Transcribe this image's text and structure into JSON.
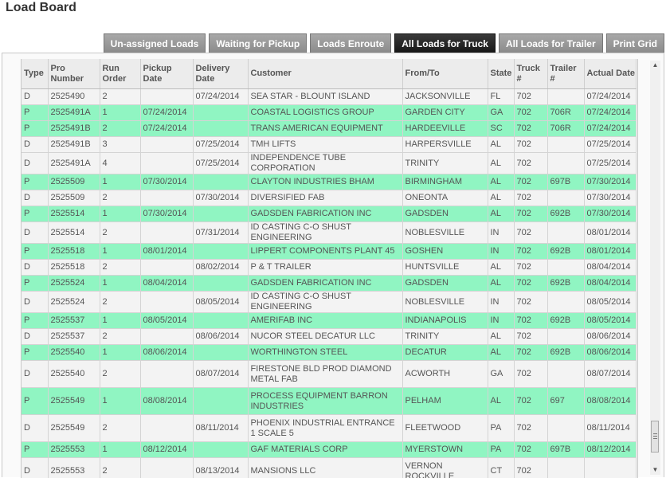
{
  "page": {
    "title": "Load Board"
  },
  "tabs": [
    {
      "label": "Un-assigned Loads",
      "active": false
    },
    {
      "label": "Waiting for Pickup",
      "active": false
    },
    {
      "label": "Loads Enroute",
      "active": false
    },
    {
      "label": "All Loads for Truck",
      "active": true
    },
    {
      "label": "All Loads for Trailer",
      "active": false
    },
    {
      "label": "Print Grid",
      "active": false
    }
  ],
  "grid": {
    "columns": [
      "Type",
      "Pro Number",
      "Run Order",
      "Pickup Date",
      "Delivery Date",
      "Customer",
      "From/To",
      "State",
      "Truck #",
      "Trailer #",
      "Actual Date"
    ],
    "rows": [
      [
        "D",
        "2525490",
        "2",
        "",
        "07/24/2014",
        "SEA STAR - BLOUNT ISLAND",
        "JACKSONVILLE",
        "FL",
        "702",
        "",
        "07/24/2014"
      ],
      [
        "P",
        "2525491A",
        "1",
        "07/24/2014",
        "",
        "COASTAL LOGISTICS GROUP",
        "GARDEN CITY",
        "GA",
        "702",
        "706R",
        "07/24/2014"
      ],
      [
        "P",
        "2525491B",
        "2",
        "07/24/2014",
        "",
        "TRANS AMERICAN EQUIPMENT",
        "HARDEEVILLE",
        "SC",
        "702",
        "706R",
        "07/24/2014"
      ],
      [
        "D",
        "2525491B",
        "3",
        "",
        "07/25/2014",
        "TMH LIFTS",
        "HARPERSVILLE",
        "AL",
        "702",
        "",
        "07/25/2014"
      ],
      [
        "D",
        "2525491A",
        "4",
        "",
        "07/25/2014",
        "INDEPENDENCE TUBE CORPORATION",
        "TRINITY",
        "AL",
        "702",
        "",
        "07/25/2014"
      ],
      [
        "P",
        "2525509",
        "1",
        "07/30/2014",
        "",
        "CLAYTON INDUSTRIES BHAM",
        "BIRMINGHAM",
        "AL",
        "702",
        "697B",
        "07/30/2014"
      ],
      [
        "D",
        "2525509",
        "2",
        "",
        "07/30/2014",
        "DIVERSIFIED FAB",
        "ONEONTA",
        "AL",
        "702",
        "",
        "07/30/2014"
      ],
      [
        "P",
        "2525514",
        "1",
        "07/30/2014",
        "",
        "GADSDEN FABRICATION INC",
        "GADSDEN",
        "AL",
        "702",
        "692B",
        "07/30/2014"
      ],
      [
        "D",
        "2525514",
        "2",
        "",
        "07/31/2014",
        "ID CASTING C-O SHUST ENGINEERING",
        "NOBLESVILLE",
        "IN",
        "702",
        "",
        "08/01/2014"
      ],
      [
        "P",
        "2525518",
        "1",
        "08/01/2014",
        "",
        "LIPPERT COMPONENTS PLANT 45",
        "GOSHEN",
        "IN",
        "702",
        "692B",
        "08/01/2014"
      ],
      [
        "D",
        "2525518",
        "2",
        "",
        "08/02/2014",
        "P & T TRAILER",
        "HUNTSVILLE",
        "AL",
        "702",
        "",
        "08/04/2014"
      ],
      [
        "P",
        "2525524",
        "1",
        "08/04/2014",
        "",
        "GADSDEN FABRICATION INC",
        "GADSDEN",
        "AL",
        "702",
        "692B",
        "08/04/2014"
      ],
      [
        "D",
        "2525524",
        "2",
        "",
        "08/05/2014",
        "ID CASTING C-O SHUST ENGINEERING",
        "NOBLESVILLE",
        "IN",
        "702",
        "",
        "08/05/2014"
      ],
      [
        "P",
        "2525537",
        "1",
        "08/05/2014",
        "",
        "AMERIFAB INC",
        "INDIANAPOLIS",
        "IN",
        "702",
        "692B",
        "08/05/2014"
      ],
      [
        "D",
        "2525537",
        "2",
        "",
        "08/06/2014",
        "NUCOR STEEL DECATUR LLC",
        "TRINITY",
        "AL",
        "702",
        "",
        "08/06/2014"
      ],
      [
        "P",
        "2525540",
        "1",
        "08/06/2014",
        "",
        "WORTHINGTON STEEL",
        "DECATUR",
        "AL",
        "702",
        "692B",
        "08/06/2014"
      ],
      [
        "D",
        "2525540",
        "2",
        "",
        "08/07/2014",
        "FIRESTONE BLD PROD DIAMOND METAL FAB",
        "ACWORTH",
        "GA",
        "702",
        "",
        "08/07/2014"
      ],
      [
        "P",
        "2525549",
        "1",
        "08/08/2014",
        "",
        "PROCESS EQUIPMENT BARRON INDUSTRIES",
        "PELHAM",
        "AL",
        "702",
        "697",
        "08/08/2014"
      ],
      [
        "D",
        "2525549",
        "2",
        "",
        "08/11/2014",
        "PHOENIX INDUSTRIAL ENTRANCE 1 SCALE 5",
        "FLEETWOOD",
        "PA",
        "702",
        "",
        "08/11/2014"
      ],
      [
        "P",
        "2525553",
        "1",
        "08/12/2014",
        "",
        "GAF MATERIALS CORP",
        "MYERSTOWN",
        "PA",
        "702",
        "697B",
        "08/12/2014"
      ],
      [
        "D",
        "2525553",
        "2",
        "",
        "08/13/2014",
        "MANSIONS LLC",
        "VERNON ROCKVILLE",
        "CT",
        "702",
        "",
        ""
      ]
    ]
  },
  "colors": {
    "pickup_row": "#90f5c2",
    "delivery_row": "#f3f3f3",
    "active_tab": "#222222",
    "tab": "#9a9a9a"
  },
  "icons": {
    "scroll_up": "arrow-up-icon",
    "scroll_down": "arrow-down-icon"
  }
}
